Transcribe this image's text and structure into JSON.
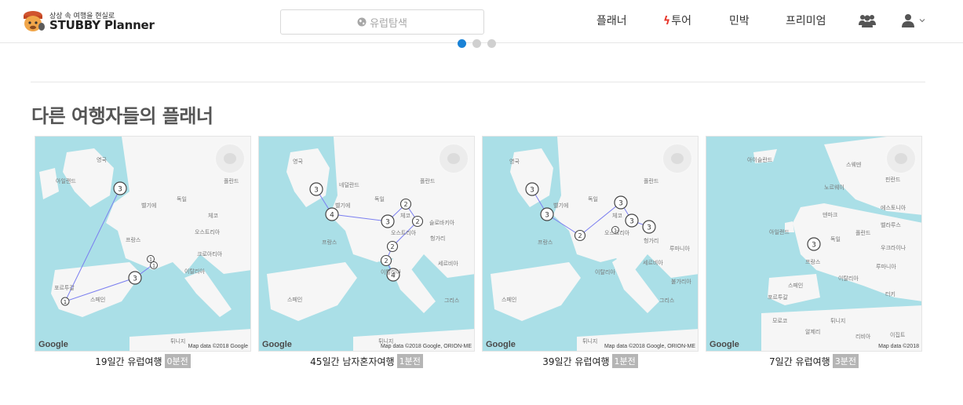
{
  "header": {
    "logo_tagline": "상상 속 여행을 현실로",
    "logo_name": "STUBBY Planner",
    "search_placeholder": "유럽탐색",
    "nav": [
      {
        "label": "플래너"
      },
      {
        "label": "투어",
        "prefix_icon": "bolt-icon"
      },
      {
        "label": "민박"
      },
      {
        "label": "프리미엄"
      }
    ],
    "icons": [
      "users-icon",
      "user-icon",
      "caret-down-icon"
    ]
  },
  "carousel": {
    "total": 3,
    "active": 1
  },
  "section": {
    "title": "다른 여행자들의 플래너"
  },
  "cards": [
    {
      "title": "19일간 유럽여행",
      "badge": "0분전",
      "credit": "Map data ©2018 Google",
      "places": [
        "영국",
        "아일랜드",
        "벨기에",
        "독일",
        "폴란드",
        "체코",
        "오스트리아",
        "프랑스",
        "크로아티아",
        "이탈리아",
        "포르투갈",
        "스페인",
        "튀니지"
      ],
      "markers": [
        "3",
        "1",
        "1",
        "3",
        "1"
      ]
    },
    {
      "title": "45일간 남자혼자여행",
      "badge": "1분전",
      "credit": "Map data ©2018 Google, ORION-ME",
      "places": [
        "영국",
        "네덜란드",
        "벨기에",
        "독일",
        "폴란드",
        "체코",
        "슬로바키아",
        "오스트리아",
        "헝가리",
        "프랑스",
        "세르비아",
        "이탈리아",
        "스페인",
        "그리스",
        "튀니지"
      ],
      "markers": [
        "3",
        "4",
        "3",
        "2",
        "2",
        "2",
        "2",
        "4"
      ]
    },
    {
      "title": "39일간 유럽여행",
      "badge": "1분전",
      "credit": "Map data ©2018 Google, ORION-ME",
      "places": [
        "영국",
        "벨기에",
        "독일",
        "폴란드",
        "체코",
        "오스트리아",
        "헝가리",
        "루마니아",
        "프랑스",
        "세르비아",
        "불가리아",
        "이탈리아",
        "스페인",
        "그리스",
        "튀니지"
      ],
      "markers": [
        "3",
        "3",
        "2",
        "3",
        "3",
        "3",
        "1"
      ]
    },
    {
      "title": "7일간 유럽여행",
      "badge": "3분전",
      "credit": "Map data ©2018",
      "places": [
        "아이슬란드",
        "스웨덴",
        "핀란드",
        "노르웨이",
        "에스토니아",
        "덴마크",
        "벨라루스",
        "아일랜드",
        "독일",
        "폴란드",
        "우크라이나",
        "프랑스",
        "루마니아",
        "스페인",
        "이탈리아",
        "터키",
        "포르투갈",
        "알제리",
        "리비아",
        "이집트",
        "모로코",
        "튀니지"
      ],
      "markers": [
        "3"
      ]
    }
  ],
  "map_attribution": "Google",
  "colors": {
    "accent": "#1a82d6",
    "sea": "#aadfe7",
    "land": "#f6f6f6",
    "route": "#7b7ff0",
    "badge": "#b5b5b5"
  }
}
